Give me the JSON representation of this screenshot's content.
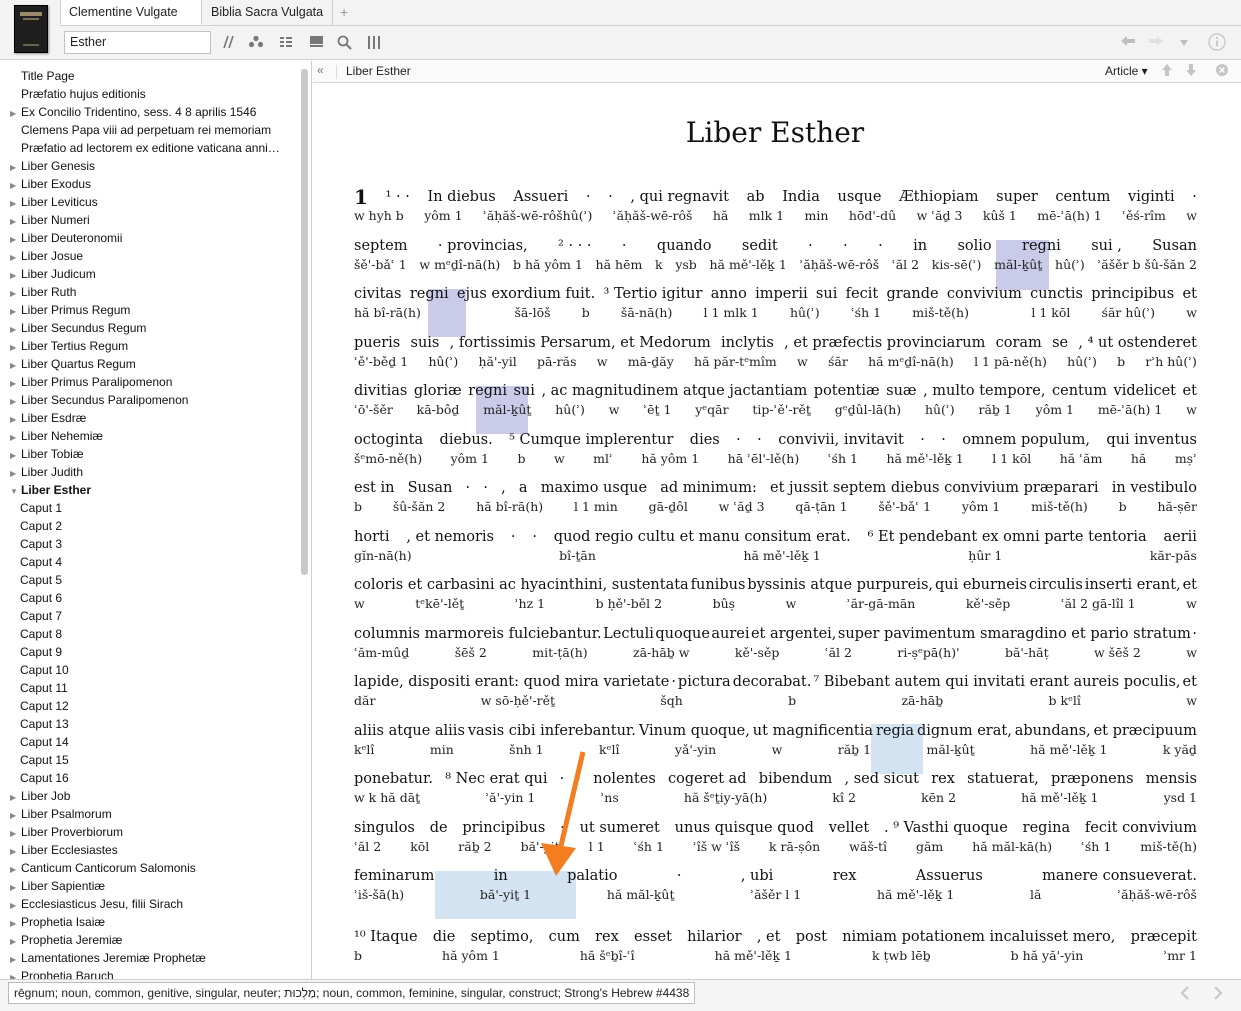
{
  "tabs": [
    {
      "label": "Clementine Vulgate",
      "active": true
    },
    {
      "label": "Biblia Sacra Vulgata",
      "active": false
    }
  ],
  "tab_add": "+",
  "search": {
    "value": "Esther"
  },
  "toolbar_icons": [
    "parallel-icon",
    "people-icon",
    "list-icon",
    "panel-icon",
    "search-icon",
    "columns-icon"
  ],
  "nav_icons": [
    "back-arrow-icon",
    "forward-arrow-icon",
    "dropdown-icon",
    "info-icon"
  ],
  "sidebar": {
    "items": [
      {
        "label": "Title Page",
        "arrow": ""
      },
      {
        "label": "Præfatio hujus editionis",
        "arrow": ""
      },
      {
        "label": "Ex Concilio Tridentino, sess. 4 8 aprilis 1546",
        "arrow": "▶"
      },
      {
        "label": "Clemens Papa viii ad perpetuam rei memoriam",
        "arrow": ""
      },
      {
        "label": "Præfatio ad lectorem ex editione vaticana anni…",
        "arrow": ""
      },
      {
        "label": "Liber Genesis",
        "arrow": "▶"
      },
      {
        "label": "Liber Exodus",
        "arrow": "▶"
      },
      {
        "label": "Liber Leviticus",
        "arrow": "▶"
      },
      {
        "label": "Liber Numeri",
        "arrow": "▶"
      },
      {
        "label": "Liber Deuteronomii",
        "arrow": "▶"
      },
      {
        "label": "Liber Josue",
        "arrow": "▶"
      },
      {
        "label": "Liber Judicum",
        "arrow": "▶"
      },
      {
        "label": "Liber Ruth",
        "arrow": "▶"
      },
      {
        "label": "Liber Primus Regum",
        "arrow": "▶"
      },
      {
        "label": "Liber Secundus Regum",
        "arrow": "▶"
      },
      {
        "label": "Liber Tertius Regum",
        "arrow": "▶"
      },
      {
        "label": "Liber Quartus Regum",
        "arrow": "▶"
      },
      {
        "label": "Liber Primus Paralipomenon",
        "arrow": "▶"
      },
      {
        "label": "Liber Secundus Paralipomenon",
        "arrow": "▶"
      },
      {
        "label": "Liber Esdræ",
        "arrow": "▶"
      },
      {
        "label": "Liber Nehemiæ",
        "arrow": "▶"
      },
      {
        "label": "Liber Tobiæ",
        "arrow": "▶"
      },
      {
        "label": "Liber Judith",
        "arrow": "▶"
      },
      {
        "label": "Liber Esther",
        "arrow": "▼",
        "bold": true
      },
      {
        "label": "Caput 1",
        "sub": true
      },
      {
        "label": "Caput 2",
        "sub": true
      },
      {
        "label": "Caput 3",
        "sub": true
      },
      {
        "label": "Caput 4",
        "sub": true
      },
      {
        "label": "Caput 5",
        "sub": true
      },
      {
        "label": "Caput 6",
        "sub": true
      },
      {
        "label": "Caput 7",
        "sub": true
      },
      {
        "label": "Caput 8",
        "sub": true
      },
      {
        "label": "Caput 9",
        "sub": true
      },
      {
        "label": "Caput 10",
        "sub": true
      },
      {
        "label": "Caput 11",
        "sub": true
      },
      {
        "label": "Caput 12",
        "sub": true
      },
      {
        "label": "Caput 13",
        "sub": true
      },
      {
        "label": "Caput 14",
        "sub": true
      },
      {
        "label": "Caput 15",
        "sub": true
      },
      {
        "label": "Caput 16",
        "sub": true
      },
      {
        "label": "Liber Job",
        "arrow": "▶"
      },
      {
        "label": "Liber Psalmorum",
        "arrow": "▶"
      },
      {
        "label": "Liber Proverbiorum",
        "arrow": "▶"
      },
      {
        "label": "Liber Ecclesiastes",
        "arrow": "▶"
      },
      {
        "label": "Canticum Canticorum Salomonis",
        "arrow": "▶"
      },
      {
        "label": "Liber Sapientiæ",
        "arrow": "▶"
      },
      {
        "label": "Ecclesiasticus Jesu, filii Sirach",
        "arrow": "▶"
      },
      {
        "label": "Prophetia Isaiæ",
        "arrow": "▶"
      },
      {
        "label": "Prophetia Jeremiæ",
        "arrow": "▶"
      },
      {
        "label": "Lamentationes Jeremiæ Prophetæ",
        "arrow": "▶"
      },
      {
        "label": "Prophetia Baruch",
        "arrow": "▶"
      }
    ]
  },
  "article": {
    "header_title": "Liber Esther",
    "mode": "Article ▾",
    "collapse": "«",
    "title": "Liber Esther",
    "chapter": "1",
    "lines": [
      {
        "latin": [
          "¹ ·  ·",
          "In diebus",
          "Assueri",
          "·",
          "·",
          ", qui regnavit",
          "ab",
          "India",
          "usque",
          "Æthiopiam",
          "super",
          "centum",
          "viginti",
          "·"
        ],
        "heb": [
          "w hyh b",
          "yôm 1",
          "ʾăḥăš-wē-rôšhû(ʾ)",
          "ʾăḥăš-wē-rôš",
          "hă",
          "mlk 1",
          "min",
          "hōd'-dû",
          "w ʿăḏ 3",
          "kûš 1",
          "mē-ʾā(h) 1",
          "ʿěś-rîm",
          "w"
        ]
      },
      {
        "latin": [
          "septem",
          "· provincias,",
          "² ·  ·  ·",
          "·",
          "quando",
          "sedit",
          "·",
          "·",
          "·",
          "in",
          "solio",
          "regni",
          "sui ,",
          "Susan"
        ],
        "heb": [
          "šě'-bǎʿ 1",
          "w mᵉḏî-nā(h)",
          "b hă yôm 1",
          "hă hēm",
          "k",
          "ysb",
          "hă mě'-lěḵ 1",
          "ʾăḥăš-wē-rôš",
          "ʿăl 2",
          "kis-sē(ʾ)",
          "măl-ḵûṯ",
          "hû(ʾ)",
          "ʾăšěr b šû-šăn 2"
        ]
      },
      {
        "latin": [
          "civitas",
          "regni",
          "ejus exordium fuit.",
          "³ Tertio igitur",
          "anno",
          "imperii",
          "sui",
          "fecit",
          "grande",
          "convivium",
          "cunctis",
          "principibus",
          "et"
        ],
        "heb": [
          "hă bî-rā(h)",
          "",
          "",
          "šā-lōš",
          "b",
          "šā-nā(h)",
          "l 1 mlk 1",
          "hû(ʾ)",
          "ʿśh 1",
          "miš-tě(h)",
          "",
          "l 1 kōl",
          "śăr hû(ʾ)",
          "w"
        ]
      },
      {
        "latin": [
          "pueris",
          "suis",
          ", fortissimis Persarum, et Medorum",
          "inclytis",
          ", et præfectis provinciarum",
          "coram",
          "se",
          ", ⁴ ut ostenderet"
        ],
        "heb": [
          "ʿě'-běḏ 1",
          "hû(ʾ)",
          "ḥă'-yil",
          "pā-răs",
          "w",
          "mā-ḏăy",
          "hă păr-tᵉmîm",
          "w",
          "śăr",
          "hă mᵉḏî-nā(h)",
          "l 1 pā-ně(h)",
          "hû(ʾ)",
          "b",
          "rʾh hû(ʾ)"
        ]
      },
      {
        "latin": [
          "divitias",
          "gloriæ",
          "regni",
          "sui",
          ", ac magnitudinem atque jactantiam",
          "potentiæ",
          "suæ",
          ", multo tempore,",
          "centum",
          "videlicet",
          "et"
        ],
        "heb": [
          "ʿō'-šěr",
          "kā-bôḏ",
          "măl-ḵûṯ",
          "hû(ʾ)",
          "w",
          "ʾēṯ 1",
          "yᵉqār",
          "tip-ʾě'-rěṯ",
          "gᵉḏûl-lā(h)",
          "hû(ʾ)",
          "răḇ 1",
          "yôm 1",
          "mē-ʾā(h) 1",
          "w"
        ]
      },
      {
        "latin": [
          "octoginta",
          "diebus.",
          "⁵ Cumque implerentur",
          "dies",
          "·",
          "·",
          "convivii, invitavit",
          "·",
          "·",
          "omnem populum,",
          "qui inventus"
        ],
        "heb": [
          "šᵉmō-ně(h)",
          "yôm 1",
          "b",
          "w",
          "mlʾ",
          "hă yôm 1",
          "hā ʾēl'-lě(h)",
          "ʿśh 1",
          "hă mě'-lěḵ 1",
          "l 1 kōl",
          "hă ʿăm",
          "hă",
          "mṣʾ"
        ]
      },
      {
        "latin": [
          "est in",
          "Susan",
          "·",
          "·",
          ",",
          "a",
          "maximo usque",
          "ad minimum:",
          "et jussit septem diebus convivium præparari",
          "in vestibulo"
        ],
        "heb": [
          "b",
          "šû-šăn 2",
          "hă bî-rā(h)",
          "l 1 min",
          "gā-ḏôl",
          "w ʿăḏ 3",
          "qā-ṭān 1",
          "šě'-bǎʿ 1",
          "yôm 1",
          "miš-tě(h)",
          "b",
          "hă-ṣēr"
        ]
      },
      {
        "latin": [
          "horti",
          ", et nemoris",
          "·",
          "·",
          "quod regio cultu et manu consitum erat.",
          "⁶ Et pendebant ex omni parte tentoria",
          "aerii"
        ],
        "heb": [
          "gĭn-nā(h)",
          "bî-ṯān",
          "hă mě'-lěḵ 1",
          "ḥûr 1",
          "kăr-păs"
        ]
      },
      {
        "latin": [
          "coloris et carbasini ac hyacinthini, sustentata",
          "funibus",
          "byssinis atque purpureis,",
          "qui eburneis",
          "circulis",
          "inserti erant,",
          "et"
        ],
        "heb": [
          "w",
          "tᵉkē'-lěṯ",
          "ʾhz 1",
          "b ḥě'-běl 2",
          "bûṣ",
          "w",
          "ʾăr-gā-mān",
          "kě'-sěp",
          "ʿăl 2 gā-lîl 1",
          "w"
        ]
      },
      {
        "latin": [
          "columnis marmoreis fulciebantur.",
          "Lectuli",
          "quoque",
          "aurei",
          "et argentei,",
          "super pavimentum smaragdino et pario stratum",
          "·"
        ],
        "heb": [
          "ʿăm-mûḏ",
          "šēš 2",
          "mit-ṭā(h)",
          "zā-hāḇ w",
          "kě'-sěp",
          "ʿăl 2",
          "ri-ṣᵉpā(h)'",
          "bă'-hăṭ",
          "w šēš 2",
          "w"
        ]
      },
      {
        "latin": [
          "lapide, dispositi erant: quod mira varietate",
          "·",
          "pictura",
          "decorabat.",
          "⁷ Bibebant autem qui invitati erant aureis poculis,",
          "et"
        ],
        "heb": [
          "dăr",
          "w sō-ḥě'-rěṯ",
          "šqh",
          "b",
          "zā-hāḇ",
          "b kᵉlî",
          "w"
        ]
      },
      {
        "latin": [
          "aliis atque aliis",
          "vasis cibi inferebantur.",
          "Vinum quoque,",
          "ut magnificentia",
          "regia",
          "dignum erat,",
          "abundans,",
          "et præcipuum"
        ],
        "heb": [
          "kᵉlî",
          "min",
          "šnh 1",
          "kᵉlî",
          "yǎ'-yin",
          "w",
          "răḇ 1",
          "măl-ḵûṯ",
          "hă mě'-lěḵ 1",
          "k yăḏ"
        ]
      },
      {
        "latin": [
          "ponebatur.",
          "⁸ Nec erat qui",
          "·",
          "·",
          "nolentes",
          "cogeret ad",
          "bibendum",
          ", sed sicut",
          "rex",
          "statuerat,",
          "præponens",
          "mensis"
        ],
        "heb": [
          "w k hă dāṯ",
          "ʾă'-yin 1",
          "ʾns",
          "hă šᵉṯiy-yā(h)",
          "kî 2",
          "kēn 2",
          "hă mě'-lěḵ 1",
          "ysd 1"
        ]
      },
      {
        "latin": [
          "singulos",
          "de",
          "principibus",
          "·",
          "ut sumeret",
          "unus quisque quod",
          "vellet",
          ". ⁹ Vasthi quoque",
          "regina",
          "fecit convivium"
        ],
        "heb": [
          "ʿăl 2",
          "kōl",
          "răḇ 2",
          "bă'-yiṯ",
          "l 1",
          "ʿśh 1",
          "ʾîš w ʾîš",
          "k rā-ṣôn",
          "wăš-tî",
          "găm",
          "hă măl-kā(h)",
          "ʿśh 1",
          "miš-tě(h)"
        ]
      },
      {
        "latin": [
          "feminarum",
          "in",
          "palatio",
          "·",
          ", ubi",
          "rex",
          "Assuerus",
          "manere consueverat."
        ],
        "heb": [
          "ʾiš-šā(h)",
          "bă'-yiṯ 1",
          "hă măl-ḵûṯ",
          "ʾăšěr l 1",
          "hă mě'-lěḵ 1",
          "lă",
          "ʾăḥăš-wē-rôš"
        ]
      },
      {
        "latin": [
          "¹⁰ Itaque",
          "die",
          "septimo,",
          "cum",
          "rex",
          "esset",
          "hilarior",
          ", et",
          "post",
          "nimiam potationem incaluisset mero,",
          "præcepit"
        ],
        "heb": [
          "b",
          "hă yôm 1",
          "hă šᵉḇî-ʿî",
          "hă mě'-lěḵ 1",
          "k ṭwb lēḇ",
          "b hă yă'-yin",
          "ʾmr 1"
        ]
      }
    ]
  },
  "status": {
    "text": "rēgnum; noun, common, genitive, singular, neuter; מַלְכוּת; noun, common, feminine, singular, construct; Strong's Hebrew #4438"
  },
  "colors": {
    "highlight_primary": "#c9cbe8",
    "highlight_secondary": "#d3e3f1",
    "arrow": "#f47d1f"
  }
}
